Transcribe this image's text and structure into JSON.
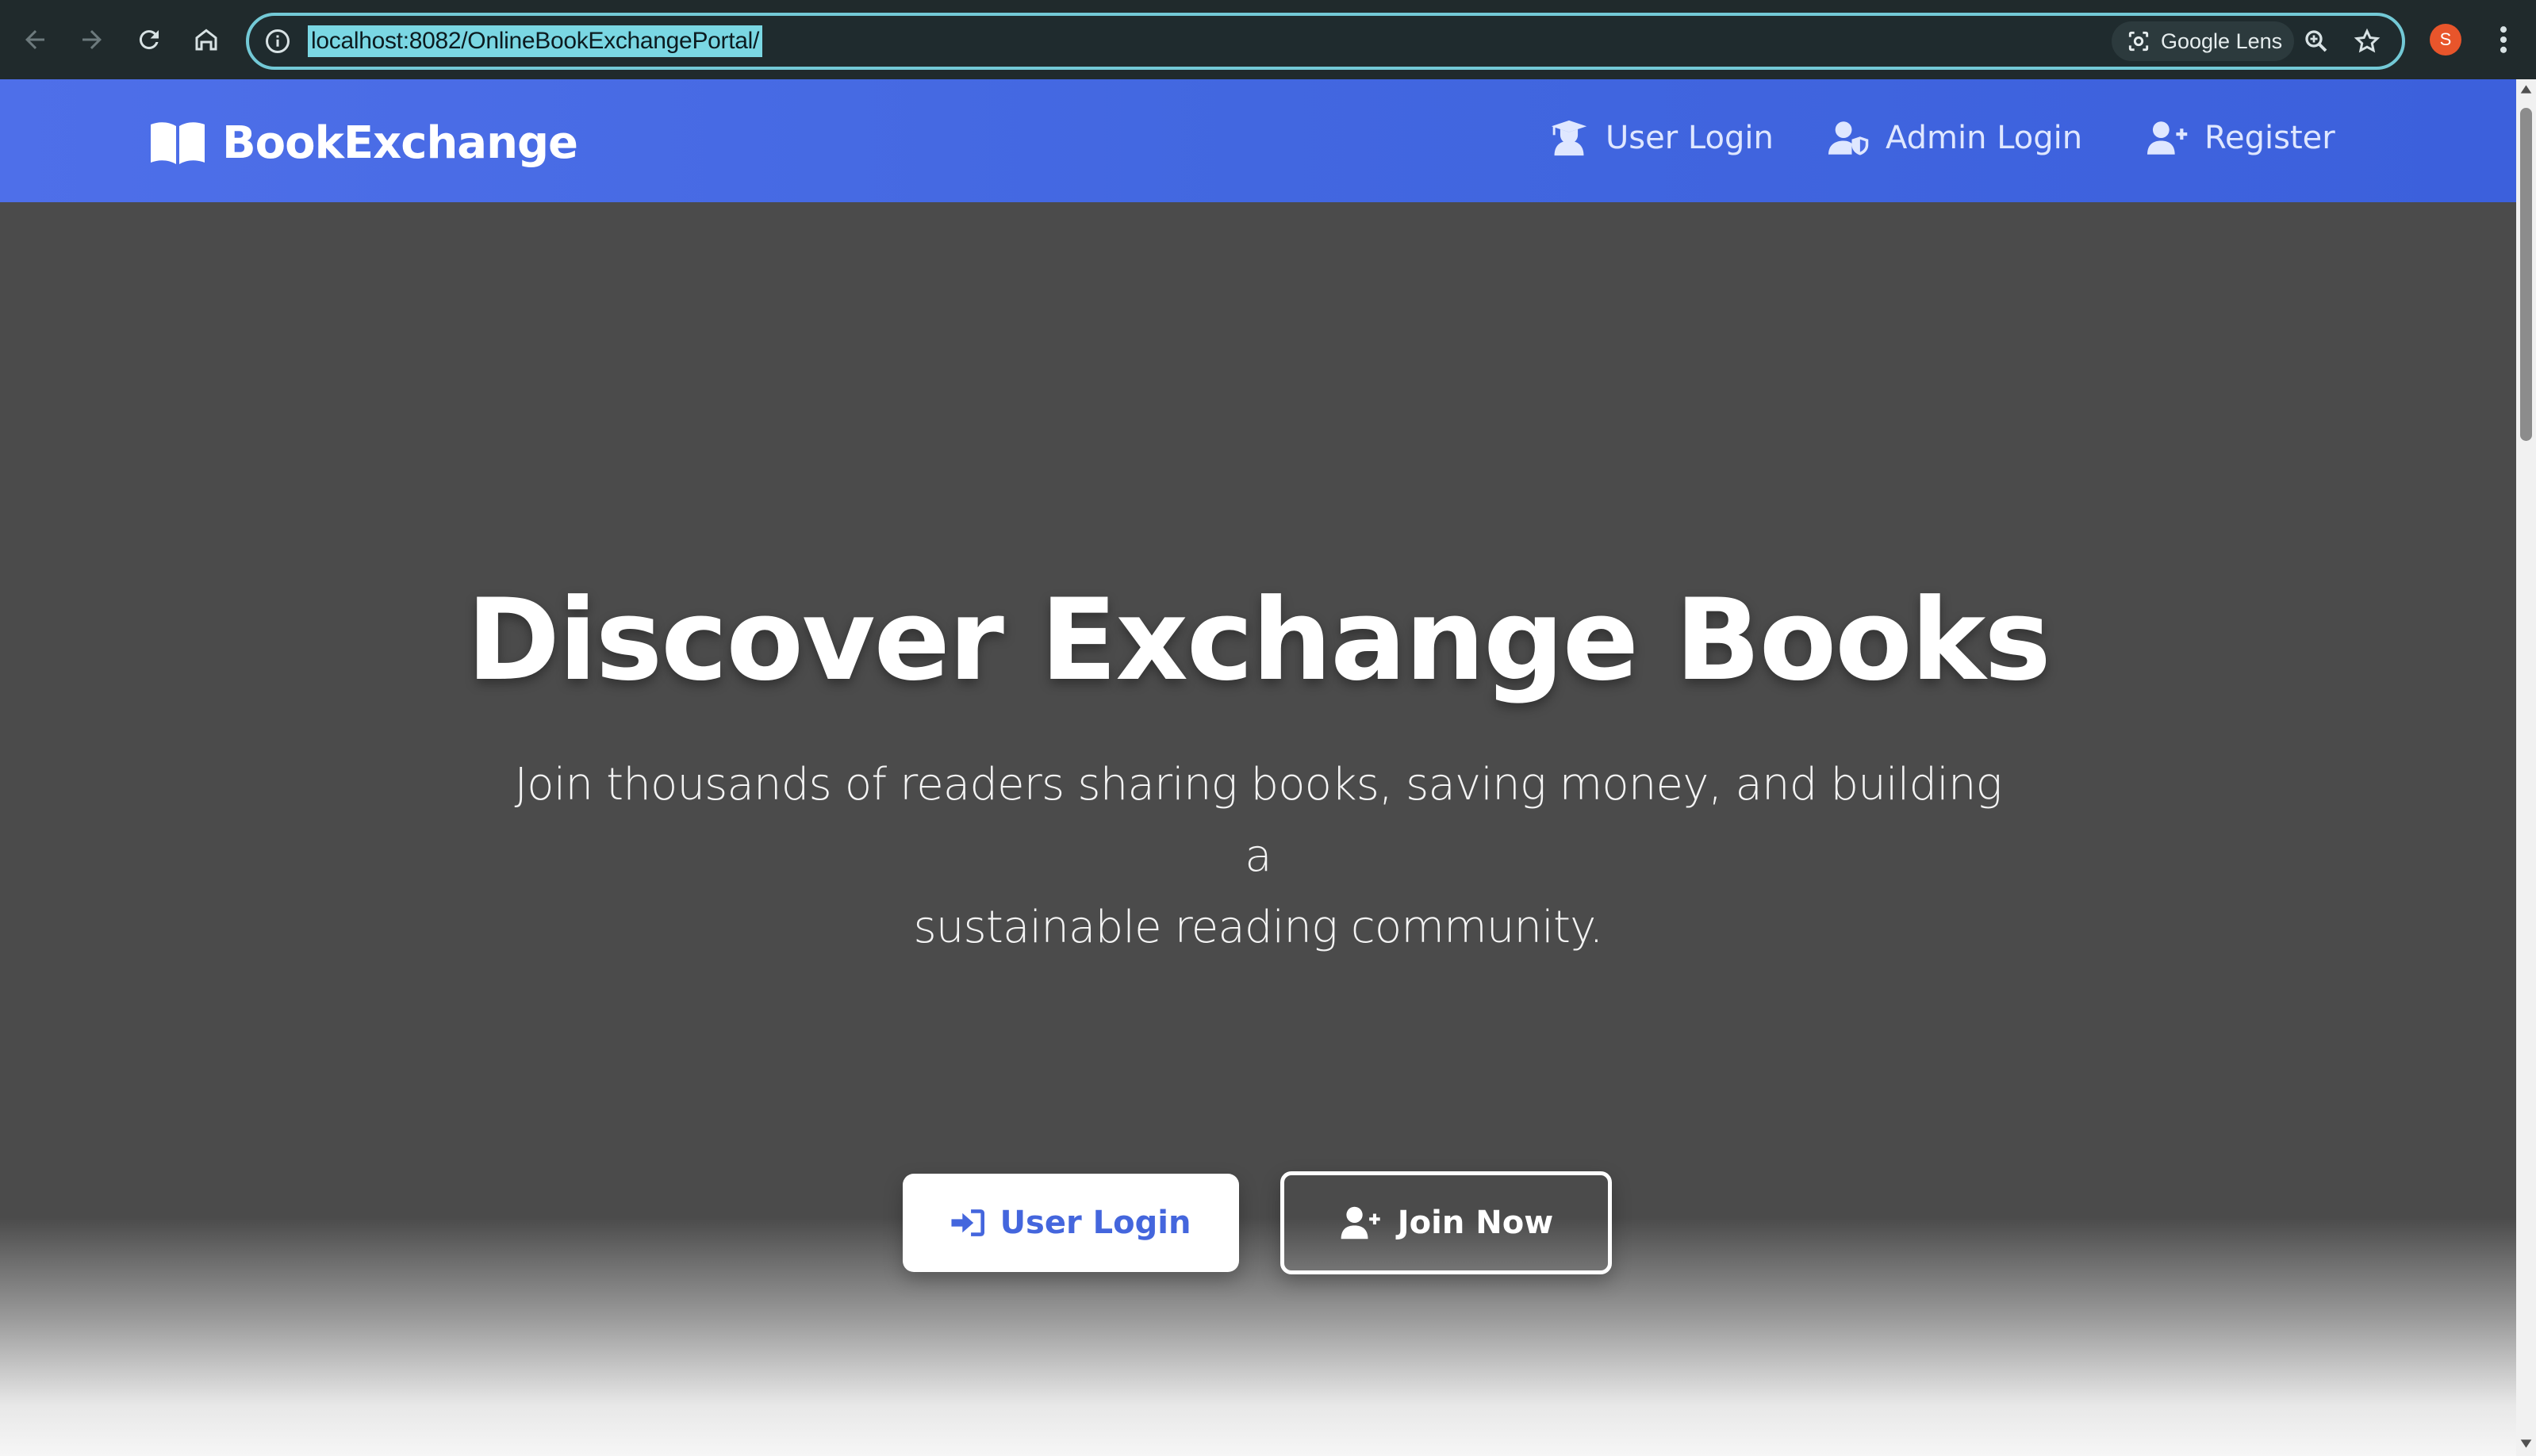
{
  "browser": {
    "url": "localhost:8082/OnlineBookExchangePortal/",
    "lens_label": "Google Lens",
    "profile_initial": "S",
    "icons": [
      "back-icon",
      "forward-icon",
      "reload-icon",
      "home-icon",
      "site-info-icon",
      "google-lens-icon",
      "zoom-icon",
      "bookmark-star-icon",
      "more-menu-icon"
    ]
  },
  "navbar": {
    "brand": "BookExchange",
    "links": [
      {
        "label": "User Login",
        "icon": "user-graduate-icon"
      },
      {
        "label": "Admin Login",
        "icon": "user-shield-icon"
      },
      {
        "label": "Register",
        "icon": "user-plus-icon"
      }
    ]
  },
  "hero": {
    "title": "Discover Exchange Books",
    "subtitle_line1": "Join thousands of readers sharing books, saving money, and building a",
    "subtitle_line2": "sustainable reading community.",
    "primary_button": "User Login",
    "secondary_button": "Join Now"
  },
  "colors": {
    "navbar_gradient_start": "#4e6fe9",
    "navbar_gradient_end": "#3c60dc",
    "hero_background": "#4b4b4b",
    "primary_button_text": "#4466dd",
    "browser_chrome": "#202a2c",
    "omnibox_focus": "#73c9d6"
  }
}
